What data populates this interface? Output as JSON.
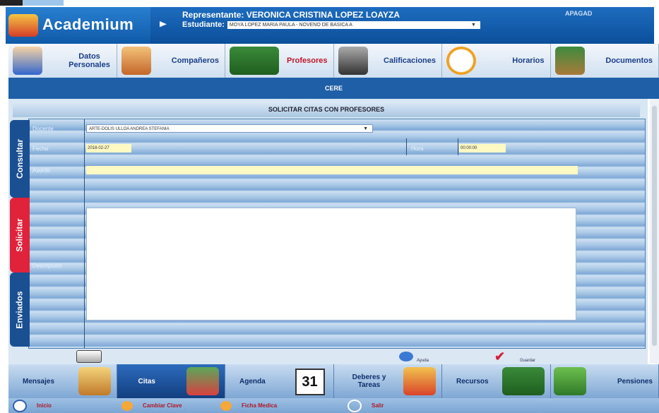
{
  "app": {
    "name": "Academium",
    "top_right": "APAGAD"
  },
  "header": {
    "representante_label": "Representante:",
    "representante_name": "VERONICA CRISTINA LOPEZ LOAYZA",
    "estudiante_label": "Estudiante:",
    "estudiante_value": "MOYA LOPEZ MARIA PAULA - NOVENO DE BASICA A"
  },
  "main_nav": [
    {
      "label": "Datos Personales",
      "icon": "person-icon"
    },
    {
      "label": "Compañeros",
      "icon": "classmates-icon"
    },
    {
      "label": "Profesores",
      "icon": "teacher-icon"
    },
    {
      "label": "Calificaciones",
      "icon": "grades-icon"
    },
    {
      "label": "Horarios",
      "icon": "clock-icon"
    },
    {
      "label": "Documentos",
      "icon": "books-icon"
    }
  ],
  "section": {
    "title": "CERE",
    "subtitle": "SOLICITAR CITAS CON PROFESORES"
  },
  "side_tabs": {
    "consultar": "Consultar",
    "solicitar": "Solicitar",
    "enviados": "Enviados"
  },
  "form": {
    "docente_label": "Docente",
    "docente_value": "ARTE-DOLIS ULLOA ANDREA STEFANIA",
    "fecha_label": "Fecha",
    "fecha_value": "2018-02-27",
    "hora_label": "Hora",
    "hora_value": "00:00:00",
    "asunto_label": "Asunto",
    "descripcion_label": "Descripción"
  },
  "actions": {
    "ayuda": "Ayuda",
    "guardar": "Guardar"
  },
  "bottom_nav": [
    {
      "label": "Mensajes",
      "icon": "messages-icon"
    },
    {
      "label": "Citas",
      "icon": "meeting-icon"
    },
    {
      "label": "Agenda",
      "icon": "calendar-icon",
      "day": "31"
    },
    {
      "label": "Deberes y Tareas",
      "icon": "homework-icon"
    },
    {
      "label": "Recursos",
      "icon": "resources-icon"
    },
    {
      "label": "Pensiones",
      "icon": "money-icon"
    }
  ],
  "footer": {
    "inicio": "Inicio",
    "cambiar_clave": "Cambiar Clave",
    "ficha_medica": "Ficha Medica",
    "salir": "Salir"
  }
}
